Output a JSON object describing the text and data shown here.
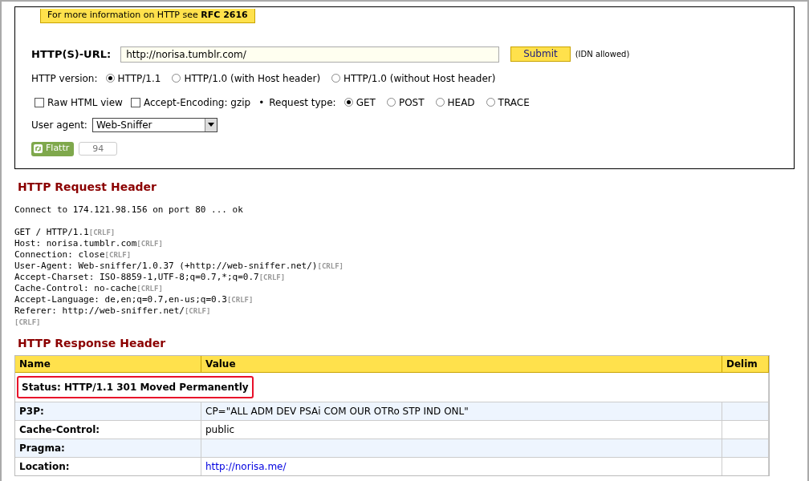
{
  "legend": {
    "text": "For more information on HTTP see",
    "link": "RFC 2616"
  },
  "url_field": {
    "label": "HTTP(S)-URL:",
    "value": "http://norisa.tumblr.com/",
    "submit": "Submit",
    "note": "(IDN allowed)"
  },
  "http_version": {
    "label": "HTTP version:",
    "options": [
      {
        "label": "HTTP/1.1",
        "selected": true
      },
      {
        "label": "HTTP/1.0 (with Host header)",
        "selected": false
      },
      {
        "label": "HTTP/1.0 (without Host header)",
        "selected": false
      }
    ]
  },
  "options": [
    {
      "label": "Raw HTML view",
      "checked": false
    },
    {
      "label": "Accept-Encoding: gzip",
      "checked": false
    }
  ],
  "separator": "•",
  "request_type": {
    "label": "Request type:",
    "options": [
      {
        "label": "GET",
        "selected": true
      },
      {
        "label": "POST",
        "selected": false
      },
      {
        "label": "HEAD",
        "selected": false
      },
      {
        "label": "TRACE",
        "selected": false
      }
    ]
  },
  "user_agent": {
    "label": "User agent:",
    "value": "Web-Sniffer"
  },
  "flattr": {
    "label": "Flattr",
    "count": "94"
  },
  "request_header": {
    "title": "HTTP Request Header",
    "connect": "Connect to 174.121.98.156 on port 80 ... ok",
    "lines": [
      {
        "text": "GET / HTTP/1.1",
        "crlf": "[CRLF]"
      },
      {
        "text": "Host: norisa.tumblr.com",
        "crlf": "[CRLF]"
      },
      {
        "text": "Connection: close",
        "crlf": "[CRLF]"
      },
      {
        "text": "User-Agent: Web-sniffer/1.0.37 (+http://web-sniffer.net/)",
        "crlf": "[CRLF]"
      },
      {
        "text": "Accept-Charset: ISO-8859-1,UTF-8;q=0.7,*;q=0.7",
        "crlf": "[CRLF]"
      },
      {
        "text": "Cache-Control: no-cache",
        "crlf": "[CRLF]"
      },
      {
        "text": "Accept-Language: de,en;q=0.7,en-us;q=0.3",
        "crlf": "[CRLF]"
      },
      {
        "text": "Referer: http://web-sniffer.net/",
        "crlf": "[CRLF]"
      },
      {
        "crlf": "[CRLF]"
      }
    ]
  },
  "response_header": {
    "title": "HTTP Response Header",
    "columns": [
      "Name",
      "Value",
      "Delim"
    ],
    "status": "Status: HTTP/1.1 301 Moved Permanently",
    "rows": [
      {
        "name": "P3P:",
        "value": "CP=\"ALL ADM DEV PSAi COM OUR OTRo STP IND ONL\"",
        "kind": "text"
      },
      {
        "name": "Cache-Control:",
        "value": "public",
        "kind": "text"
      },
      {
        "name": "Pragma:"
      },
      {
        "name": "Location:",
        "value": "http://norisa.me/",
        "kind": "link"
      }
    ]
  }
}
